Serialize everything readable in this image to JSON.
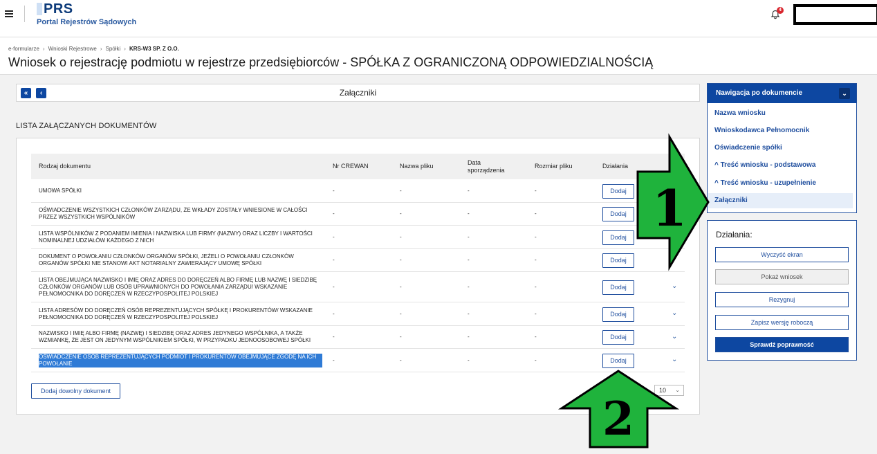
{
  "header": {
    "logo_title": "PRS",
    "logo_subtitle": "Portal Rejestrów Sądowych",
    "notification_count": "4"
  },
  "breadcrumb": [
    "e-formularze",
    "Wnioski Rejestrowe",
    "Spółki",
    "KRS-W3 SP. Z O.O."
  ],
  "page_title": "Wniosek o rejestrację podmiotu w rejestrze przedsiębiorców - SPÓŁKA Z OGRANICZONĄ ODPOWIEDZIALNOŚCIĄ",
  "section": {
    "first_label": "«",
    "prev_label": "‹",
    "title": "Załączniki"
  },
  "list_heading": "LISTA ZAŁĄCZANYCH DOKUMENTÓW",
  "table": {
    "headers": [
      "Rodzaj dokumentu",
      "Nr CREWAN",
      "Nazwa pliku",
      "Data sporządzenia",
      "Rozmiar pliku",
      "Działania"
    ],
    "rows": [
      {
        "name": "UMOWA SPÓŁKI",
        "crewan": "-",
        "file": "-",
        "date": "-",
        "size": "-",
        "action": "Dodaj",
        "expand": ""
      },
      {
        "name": "OŚWIADCZENIE WSZYSTKICH CZŁONKÓW ZARZĄDU, ŻE WKŁADY ZOSTAŁY WNIESIONE W CAŁOŚCI PRZEZ WSZYSTKICH WSPÓLNIKÓW",
        "crewan": "-",
        "file": "-",
        "date": "-",
        "size": "-",
        "action": "Dodaj",
        "expand": ""
      },
      {
        "name": "LISTA WSPÓLNIKÓW Z PODANIEM IMIENIA I NAZWISKA LUB FIRMY (NAZWY) ORAZ LICZBY I WARTOŚCI NOMINALNEJ UDZIAŁÓW KAŻDEGO Z NICH",
        "crewan": "-",
        "file": "-",
        "date": "-",
        "size": "-",
        "action": "Dodaj",
        "expand": ""
      },
      {
        "name": "DOKUMENT O POWOŁANIU CZŁONKÓW ORGANÓW SPÓŁKI, JEŻELI O POWOŁANIU CZŁONKÓW ORGANÓW SPÓŁKI NIE STANOWI AKT NOTARIALNY ZAWIERAJĄCY UMOWĘ SPÓŁKI",
        "crewan": "-",
        "file": "-",
        "date": "-",
        "size": "-",
        "action": "Dodaj",
        "expand": ""
      },
      {
        "name": "LISTA OBEJMUJĄCA NAZWISKO I IMIĘ ORAZ ADRES DO DORĘCZEŃ ALBO FIRMĘ LUB NAZWĘ I SIEDZIBĘ CZŁONKÓW ORGANÓW LUB OSÓB UPRAWNIONYCH DO POWOŁANIA ZARZĄDU/ WSKAZANIE PEŁNOMOCNIKA DO DORĘCZEŃ W RZECZYPOSPOLITEJ POLSKIEJ",
        "crewan": "-",
        "file": "-",
        "date": "-",
        "size": "-",
        "action": "Dodaj",
        "expand": "⌄"
      },
      {
        "name": "LISTA ADRESÓW DO DORĘCZEŃ OSÓB REPREZENTUJĄCYCH SPÓŁKĘ I PROKURENTÓW/ WSKAZANIE PEŁNOMOCNIKA DO DORĘCZEŃ W RZECZYPOSPOLITEJ POLSKIEJ",
        "crewan": "-",
        "file": "-",
        "date": "-",
        "size": "-",
        "action": "Dodaj",
        "expand": "⌄"
      },
      {
        "name": "NAZWISKO I IMIĘ ALBO FIRMĘ (NAZWĘ) I SIEDZIBĘ ORAZ ADRES JEDYNEGO WSPÓLNIKA, A TAKŻE WZMIANKĘ, ŻE JEST ON JEDYNYM WSPÓLNIKIEM SPÓŁKI, W PRZYPADKU JEDNOOSOBOWEJ SPÓŁKI",
        "crewan": "-",
        "file": "-",
        "date": "-",
        "size": "-",
        "action": "Dodaj",
        "expand": "⌄"
      },
      {
        "name": "OŚWIADCZENIE OSÓB REPREZENTUJĄCYCH PODMIOT I PROKURENTÓW OBEJMUJĄCE ZGODĘ NA ICH POWOŁANIE",
        "crewan": "-",
        "file": "-",
        "date": "-",
        "size": "-",
        "action": "Dodaj",
        "expand": "⌄"
      }
    ],
    "add_any_label": "Dodaj dowolny dokument",
    "page_size": "10"
  },
  "nav_panel": {
    "title": "Nawigacja po dokumencie",
    "toggle": "⌄",
    "items": [
      "Nazwa wniosku",
      "Wnioskodawca Pełnomocnik",
      "Oświadczenie spółki",
      "^ Treść wniosku - podstawowa",
      "^ Treść wniosku - uzupełnienie",
      "Załączniki"
    ]
  },
  "actions_panel": {
    "title": "Działania:",
    "buttons": [
      "Wyczyść ekran",
      "Pokaż wniosek",
      "Rezygnuj",
      "Zapisz wersję roboczą",
      "Sprawdź poprawność"
    ]
  },
  "annotations": {
    "arrow1_label": "1",
    "arrow2_label": "2",
    "arrow_color": "#1fb33c"
  }
}
